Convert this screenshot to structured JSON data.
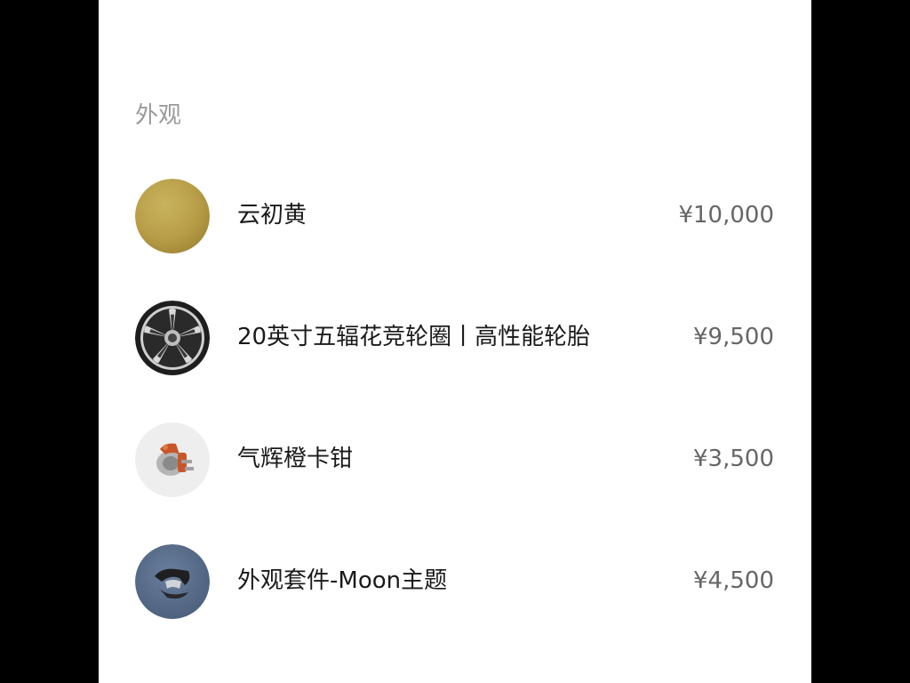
{
  "section": {
    "title": "外观"
  },
  "items": [
    {
      "name": "云初黄",
      "price": "¥10,000",
      "icon": "paint-swatch-icon",
      "color": "#b9a04c"
    },
    {
      "name": "20英寸五辐花竞轮圈丨高性能轮胎",
      "price": "¥9,500",
      "icon": "wheel-icon"
    },
    {
      "name": "气辉橙卡钳",
      "price": "¥3,500",
      "icon": "brake-caliper-icon",
      "color": "#c8562a"
    },
    {
      "name": "外观套件-Moon主题",
      "price": "¥4,500",
      "icon": "moon-theme-logo-icon",
      "color": "#5a6e8c"
    }
  ]
}
